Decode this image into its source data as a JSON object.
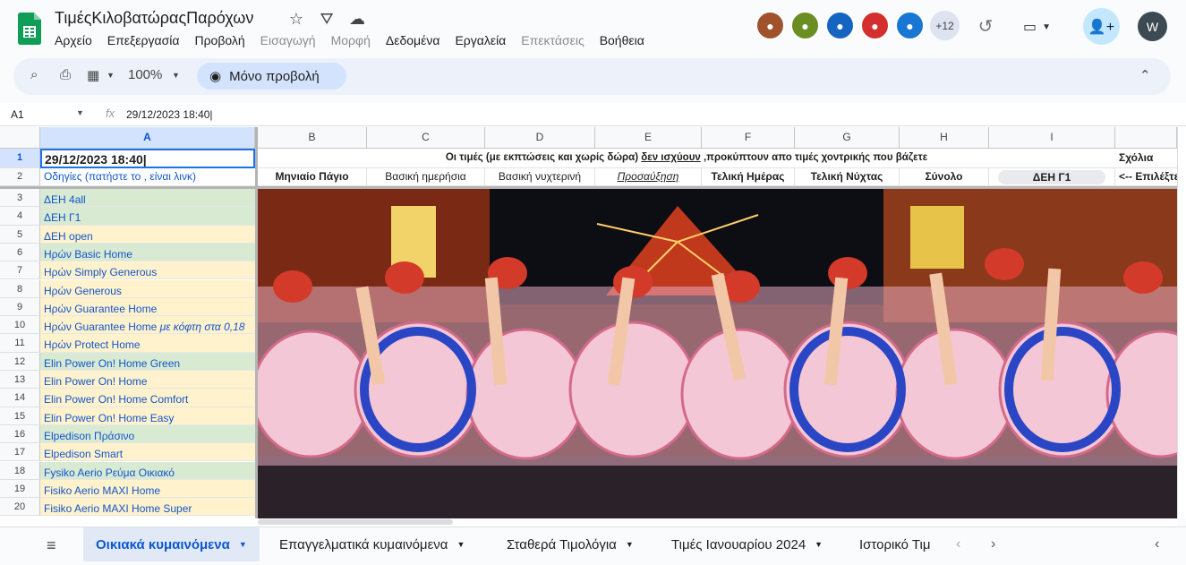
{
  "doc": {
    "title": "ΤιμέςΚιλοβατώραςΠαρόχων"
  },
  "menu": [
    "Αρχείο",
    "Επεξεργασία",
    "Προβολή",
    "Εισαγωγή",
    "Μορφή",
    "Δεδομένα",
    "Εργαλεία",
    "Επεκτάσεις",
    "Βοήθεια"
  ],
  "menu_disabled": [
    "Εισαγωγή",
    "Μορφή",
    "Επεκτάσεις"
  ],
  "collaborators": {
    "more": "+12"
  },
  "account": {
    "initial": "W"
  },
  "toolbar": {
    "zoom": "100%",
    "view_only": "Μόνο προβολή"
  },
  "formula_bar": {
    "cell_ref": "A1",
    "fx": "fx",
    "value": "29/12/2023 18:40|"
  },
  "columns": [
    "A",
    "B",
    "C",
    "D",
    "E",
    "F",
    "G",
    "H",
    "I"
  ],
  "rows": {
    "r1": {
      "num": "1",
      "a": "29/12/2023 18:40|",
      "note": "Οι τιμές (με εκπτώσεις και χωρίς δώρα) ",
      "note_u": "δεν ισχύουν",
      "note_tail": " ,προκύπτουν απο τιμές χοντρικής που βάζετε",
      "comments": "Σχόλια"
    },
    "r2": {
      "num": "2",
      "a": "Οδηγίες (πατήστε το , είναι λινκ)",
      "b": "Μηνιαίο Πάγιο",
      "c": "Βασική ημερήσια",
      "d": "Βασική νυχτερινή",
      "e": "Προσαύξηση",
      "f": "Τελική Ημέρας",
      "g": "Τελική Νύχτας",
      "h": "Σύνολο",
      "i": "ΔΕΗ Γ1",
      "j": "<-- Επιλέξτε"
    }
  },
  "providers": [
    {
      "num": "3",
      "name": "ΔΕΗ 4all",
      "color": "green"
    },
    {
      "num": "4",
      "name": "ΔΕΗ Γ1",
      "color": "green"
    },
    {
      "num": "5",
      "name": "ΔΕΗ open",
      "color": "yellow"
    },
    {
      "num": "6",
      "name": "Ηρών Basic Home",
      "color": "green"
    },
    {
      "num": "7",
      "name": "Ηρών  Simply Generous",
      "color": "yellow"
    },
    {
      "num": "8",
      "name": "Ηρών Generous",
      "color": "yellow"
    },
    {
      "num": "9",
      "name": "Ηρών Guarantee Home",
      "color": "yellow"
    },
    {
      "num": "10",
      "name": "Ηρών Guarantee Home",
      "italic": "με κόφτη στα 0,18",
      "color": "yellow"
    },
    {
      "num": "11",
      "name": "Ηρών Protect Home",
      "color": "yellow"
    },
    {
      "num": "12",
      "name": "Elin Power On! Home Green",
      "color": "green"
    },
    {
      "num": "13",
      "name": "Elin Power On! Home",
      "color": "yellow"
    },
    {
      "num": "14",
      "name": "Elin Power On! Home Comfort",
      "color": "yellow"
    },
    {
      "num": "15",
      "name": "Elin Power On! Home Easy",
      "color": "yellow"
    },
    {
      "num": "16",
      "name": "Elpedison Πράσινο",
      "color": "green"
    },
    {
      "num": "17",
      "name": "Elpedison Smart",
      "color": "yellow"
    },
    {
      "num": "18",
      "name": "Fysiko Aerio Ρεύμα Οικιακό",
      "color": "green"
    },
    {
      "num": "19",
      "name": "Fisiko Aerio MAXI Home",
      "color": "yellow"
    },
    {
      "num": "20",
      "name": "Fisiko Aerio MAXI Home Super",
      "color": "yellow"
    }
  ],
  "sheets": [
    "Οικιακά κυμαινόμενα",
    "Επαγγελματικά κυμαινόμενα",
    "Σταθερά Τιμολόγια",
    "Τιμές Ιανουαρίου 2024",
    "Ιστορικό Τιμ"
  ],
  "colors": {
    "accent": "#0b57d0",
    "selected_header": "#d3e3fd",
    "yellow_fill": "#fff2cc",
    "green_fill": "#d9ead3",
    "link": "#1155cc"
  }
}
